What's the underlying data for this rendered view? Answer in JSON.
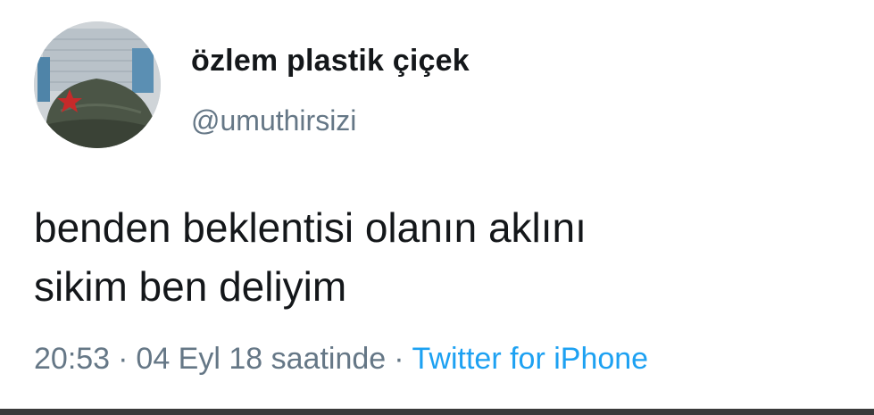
{
  "user": {
    "display_name": "özlem plastik çiçek",
    "handle": "@umuthirsizi"
  },
  "tweet": {
    "lines": [
      "benden beklentisi olanın aklını",
      "sikim ben deliyim"
    ]
  },
  "meta": {
    "time": "20:53",
    "date": "04 Eyl 18 saatinde",
    "separator": "·",
    "source": "Twitter for iPhone"
  },
  "colors": {
    "text": "#14171a",
    "secondary": "#657786",
    "link": "#1da1f2"
  }
}
